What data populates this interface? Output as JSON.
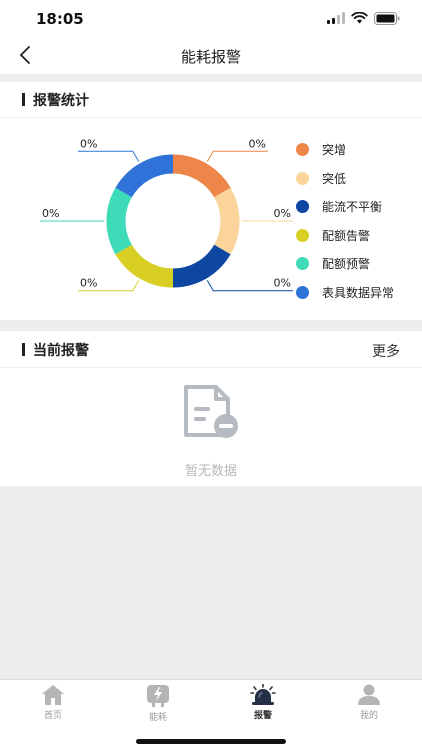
{
  "status_bar": {
    "time": "18:05"
  },
  "nav": {
    "title": "能耗报警"
  },
  "stats_card": {
    "title": "报警统计"
  },
  "chart_data": {
    "type": "pie",
    "subtype": "donut",
    "categories": [
      "突增",
      "突低",
      "能流不平衡",
      "配额告警",
      "配额预警",
      "表具数据异常"
    ],
    "values": [
      0,
      0,
      0,
      0,
      0,
      0
    ],
    "data_labels": [
      "0%",
      "0%",
      "0%",
      "0%",
      "0%",
      "0%"
    ],
    "colors": [
      "#ee8549",
      "#fad49b",
      "#0d47a1",
      "#d9cf24",
      "#3ddbb8",
      "#2f73d9"
    ],
    "legend_position": "right"
  },
  "alerts_card": {
    "title": "当前报警",
    "more_label": "更多",
    "empty_text": "暂无数据"
  },
  "tab_bar": {
    "items": [
      {
        "label": "首页",
        "icon": "home-icon",
        "active": false
      },
      {
        "label": "能耗",
        "icon": "energy-icon",
        "active": false
      },
      {
        "label": "报警",
        "icon": "alarm-icon",
        "active": true
      },
      {
        "label": "我的",
        "icon": "profile-icon",
        "active": false
      }
    ]
  }
}
